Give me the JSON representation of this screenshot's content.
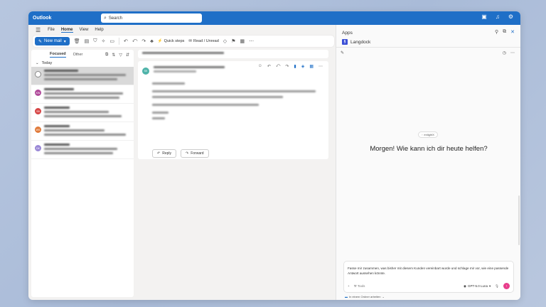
{
  "window": {
    "app_name": "Outlook"
  },
  "search": {
    "placeholder": "Search",
    "icon": "search-icon"
  },
  "titlebar_icons": [
    "calendar-icon",
    "bell-icon",
    "gear-icon"
  ],
  "ribbon": {
    "tabs": [
      {
        "label": "File",
        "active": false
      },
      {
        "label": "Home",
        "active": true
      },
      {
        "label": "View",
        "active": false
      },
      {
        "label": "Help",
        "active": false
      }
    ]
  },
  "toolbar": {
    "new_mail": "New mail",
    "quick_steps": "Quick steps",
    "read_unread": "Read / Unread"
  },
  "maillist": {
    "tabs": {
      "focused": "Focused",
      "other": "Other"
    },
    "group_label": "Today",
    "items": [
      {
        "initials": "",
        "color": "#ffffff",
        "selected": true
      },
      {
        "initials": "KW",
        "color": "#b04a9a",
        "selected": false
      },
      {
        "initials": "SB",
        "color": "#d64545",
        "selected": false
      },
      {
        "initials": "WS",
        "color": "#e07a3a",
        "selected": false
      },
      {
        "initials": "DK",
        "color": "#9a88d6",
        "selected": false
      }
    ]
  },
  "reading": {
    "sender_initials": "SK",
    "reply": "Reply",
    "forward": "Forward"
  },
  "apps": {
    "title": "Apps",
    "addin_name": "Langdock",
    "chip_label": "enlightX",
    "greeting": "Morgen! Wie kann ich dir heute helfen?",
    "prompt_text": "Fasse mir zusammen, was bisher mit diesem Kunden vereinbart wurde und schlage mir vor, wie eine passende Antwort aussehen könnte.",
    "tools_label": "Tools",
    "model": "GPT-5.0 Luna",
    "attach_note": "In einem Ordner arbeiten"
  },
  "colors": {
    "accent": "#1f6fc7",
    "send": "#e83e8c"
  }
}
